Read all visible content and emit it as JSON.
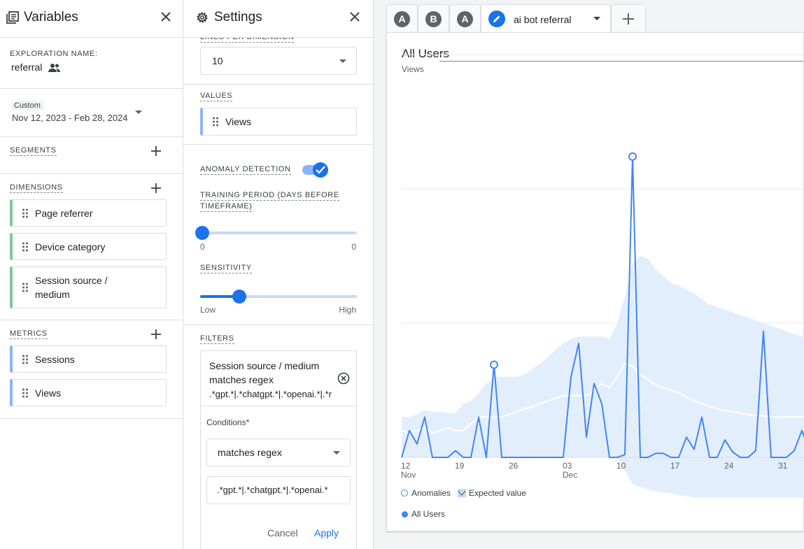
{
  "variables_panel": {
    "title": "Variables",
    "exploration_name_label": "EXPLORATION NAME:",
    "exploration_name": "referral",
    "date_range": {
      "badge": "Custom",
      "value": "Nov 12, 2023 - Feb 28, 2024"
    },
    "segments_label": "SEGMENTS",
    "dimensions_label": "DIMENSIONS",
    "dimensions": [
      "Page referrer",
      "Device category",
      "Session source /",
      "medium"
    ],
    "metrics_label": "METRICS",
    "metrics": [
      "Sessions",
      "Views"
    ]
  },
  "settings_panel": {
    "title": "Settings",
    "lines_per_dimension_label": "LINES PER DIMENSION",
    "lines_per_dimension_value": "10",
    "values_label": "VALUES",
    "values_chip": "Views",
    "anomaly_detection_label": "ANOMALY DETECTION",
    "anomaly_detection_on": true,
    "training_period_label_line1": "TRAINING PERIOD (DAYS BEFORE",
    "training_period_label_line2": "TIMEFRAME)",
    "training_min": "0",
    "training_max": "0",
    "training_level": 0,
    "sensitivity_label": "SENSITIVITY",
    "sensitivity_low": "Low",
    "sensitivity_high": "High",
    "sensitivity_level": 0.25,
    "filters_label": "FILTERS",
    "filter_summary_line1": "Session source / medium",
    "filter_summary_line2": "matches regex",
    "filter_summary_line3": ".*gpt.*|.*chatgpt.*|.*openai.*|.*r",
    "conditions_label": "Conditions*",
    "condition_match_type": "matches regex",
    "condition_value": ".*gpt.*|.*chatgpt.*|.*openai.*",
    "cancel_label": "Cancel",
    "apply_label": "Apply"
  },
  "tabs": [
    {
      "letter": "A"
    },
    {
      "letter": "B"
    },
    {
      "letter": "A"
    },
    {
      "label": "ai bot referral",
      "active": true
    }
  ],
  "colors": {
    "accent": "#1a73e8",
    "line": "#4285f4",
    "band": "#e3eefd",
    "expected": "#ffffff",
    "dimension_bar": "#81c995",
    "metric_bar": "#8ab4f8"
  },
  "chart_data": {
    "type": "line",
    "title": "All Users",
    "ylabel": "Views",
    "x_ticks": [
      {
        "label": "12",
        "sub": "Nov",
        "day": 0
      },
      {
        "label": "19",
        "sub": "",
        "day": 7
      },
      {
        "label": "26",
        "sub": "",
        "day": 14
      },
      {
        "label": "03",
        "sub": "Dec",
        "day": 21
      },
      {
        "label": "10",
        "sub": "",
        "day": 28
      },
      {
        "label": "17",
        "sub": "",
        "day": 35
      },
      {
        "label": "24",
        "sub": "",
        "day": 42
      },
      {
        "label": "31",
        "sub": "",
        "day": 49
      }
    ],
    "gridlines": [
      1,
      2,
      3
    ],
    "ylim": [
      0,
      4
    ],
    "series": [
      {
        "name": "All Users",
        "values": [
          0,
          0.2,
          0.1,
          0.3,
          0,
          0,
          0,
          0.05,
          0,
          0,
          0.3,
          0,
          0.69,
          0,
          0,
          0,
          0,
          0,
          0,
          0,
          0,
          0,
          0.6,
          0.85,
          0.15,
          0.55,
          0.4,
          0,
          0,
          0.02,
          2.24,
          0,
          0,
          0.03,
          0.03,
          0,
          0,
          0.15,
          0.06,
          0.3,
          0,
          0,
          0.13,
          0.04,
          0,
          0,
          0.05,
          0.94,
          0,
          0,
          0,
          0.05,
          0.2,
          0.05
        ]
      }
    ],
    "expected": [
      0.2,
      0.18,
      0.2,
      0.22,
      0.18,
      0.2,
      0.22,
      0.2,
      0.2,
      0.25,
      0.3,
      0.3,
      0.3,
      0.3,
      0.32,
      0.34,
      0.36,
      0.38,
      0.4,
      0.42,
      0.44,
      0.46,
      0.46,
      0.46,
      0.46,
      0.5,
      0.55,
      0.52,
      0.6,
      0.7,
      0.68,
      0.62,
      0.58,
      0.54,
      0.52,
      0.5,
      0.48,
      0.45,
      0.42,
      0.4,
      0.38,
      0.36,
      0.35,
      0.34,
      0.33,
      0.32,
      0.31,
      0.31,
      0.3,
      0.3,
      0.3,
      0.3,
      0.3,
      0.3
    ],
    "band_upper": [
      0.3,
      0.3,
      0.32,
      0.35,
      0.34,
      0.34,
      0.33,
      0.33,
      0.4,
      0.42,
      0.48,
      0.55,
      0.6,
      0.6,
      0.6,
      0.6,
      0.62,
      0.66,
      0.7,
      0.75,
      0.8,
      0.85,
      0.88,
      0.9,
      0.9,
      0.9,
      0.9,
      0.88,
      1.0,
      1.2,
      1.45,
      1.5,
      1.48,
      1.4,
      1.35,
      1.3,
      1.28,
      1.25,
      1.22,
      1.18,
      1.14,
      1.12,
      1.1,
      1.08,
      1.06,
      1.04,
      1.02,
      1.0,
      0.98,
      0.96,
      0.94,
      0.92,
      0.9,
      0.88
    ],
    "band_lower": [
      0,
      0,
      0,
      0,
      0,
      0,
      0,
      0,
      0,
      0,
      0,
      0,
      0,
      0,
      0,
      0,
      0,
      0,
      0,
      0,
      0,
      0,
      0,
      0,
      0,
      0,
      0,
      0,
      0,
      -0.1,
      -0.2,
      -0.22,
      -0.24,
      -0.25,
      -0.26,
      -0.27,
      -0.28,
      -0.29,
      -0.3,
      -0.3,
      -0.3,
      -0.3,
      -0.3,
      -0.3,
      -0.3,
      -0.3,
      -0.3,
      -0.3,
      -0.3,
      -0.3,
      -0.3,
      -0.3,
      -0.3,
      -0.3
    ],
    "anomalies": [
      12,
      30
    ],
    "legend": {
      "anomalies": "Anomalies",
      "expected": "Expected value",
      "series": "All Users"
    }
  }
}
